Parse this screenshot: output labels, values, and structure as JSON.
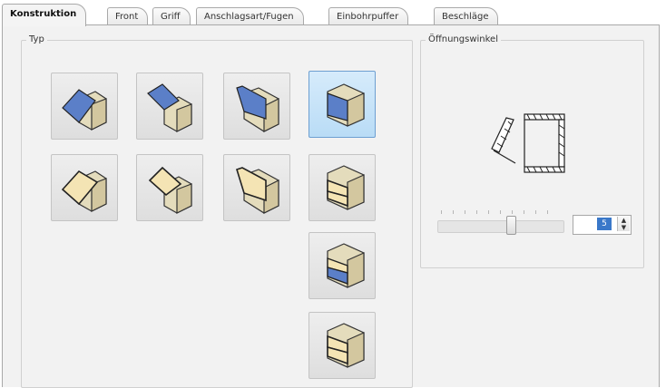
{
  "tabs": [
    {
      "label": "Konstruktion",
      "active": true
    },
    {
      "label": "Front",
      "active": false
    },
    {
      "label": "Griff",
      "active": false
    },
    {
      "label": "Anschlagsart/Fugen",
      "active": false
    },
    {
      "label": "Einbohrpuffer",
      "active": false
    },
    {
      "label": "Beschläge",
      "active": false
    }
  ],
  "typ_group": {
    "title": "Typ",
    "selected_index": 3,
    "icons": [
      "flap-up-blue-icon",
      "flap-up-open-blue-icon",
      "flap-down-blue-icon",
      "flap-front-blue-icon",
      "flap-up-cream-icon",
      "flap-up-open-cream-icon",
      "flap-down-cream-icon",
      "flap-front-cream-icon",
      "flap-front-blue-variant-icon",
      "flap-front-cream-variant-icon"
    ]
  },
  "oeffnung_group": {
    "title": "Öffnungswinkel",
    "preview_icon": "opening-angle-diagram-icon",
    "slider_value_fraction": 0.6,
    "spin_value": "5"
  },
  "colors": {
    "panel_bg": "#f2f2f2",
    "selected_bg": "#c7e3f9",
    "blue_front": "#5b7fc8",
    "cream_front": "#f4e4b4",
    "cabinet_body": "#e4dcbc"
  }
}
